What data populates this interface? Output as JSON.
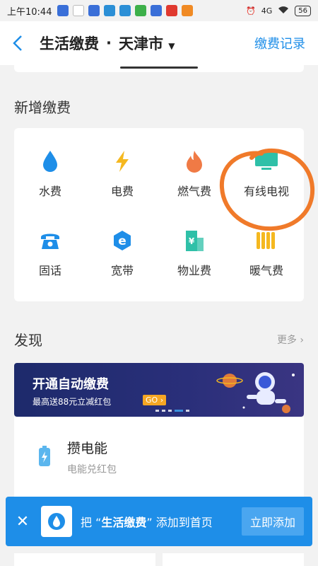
{
  "status": {
    "time": "上午10:44",
    "signal": "4G",
    "battery": "56"
  },
  "nav": {
    "title": "生活缴费",
    "separator": "·",
    "city": "天津市",
    "record": "缴费记录"
  },
  "section_new": {
    "title": "新增缴费"
  },
  "grid": [
    {
      "label": "水费",
      "icon": "water-drop-icon"
    },
    {
      "label": "电费",
      "icon": "lightning-icon"
    },
    {
      "label": "燃气费",
      "icon": "flame-icon"
    },
    {
      "label": "有线电视",
      "icon": "tv-icon"
    },
    {
      "label": "固话",
      "icon": "telephone-icon"
    },
    {
      "label": "宽带",
      "icon": "broadband-e-icon"
    },
    {
      "label": "物业费",
      "icon": "building-yen-icon"
    },
    {
      "label": "暖气费",
      "icon": "radiator-icon"
    }
  ],
  "section_discover": {
    "title": "发现",
    "more": "更多"
  },
  "banner": {
    "title": "开通自动缴费",
    "subtitle": "最高送88元立减红包",
    "go": "GO"
  },
  "energy": {
    "title": "攒电能",
    "subtitle": "电能兑红包"
  },
  "toast": {
    "prefix": "把 “",
    "app": "生活缴费",
    "suffix": "” 添加到首页",
    "button": "立即添加"
  },
  "colors": {
    "accent": "#1e8ee8",
    "annotation": "#f07a2a"
  }
}
